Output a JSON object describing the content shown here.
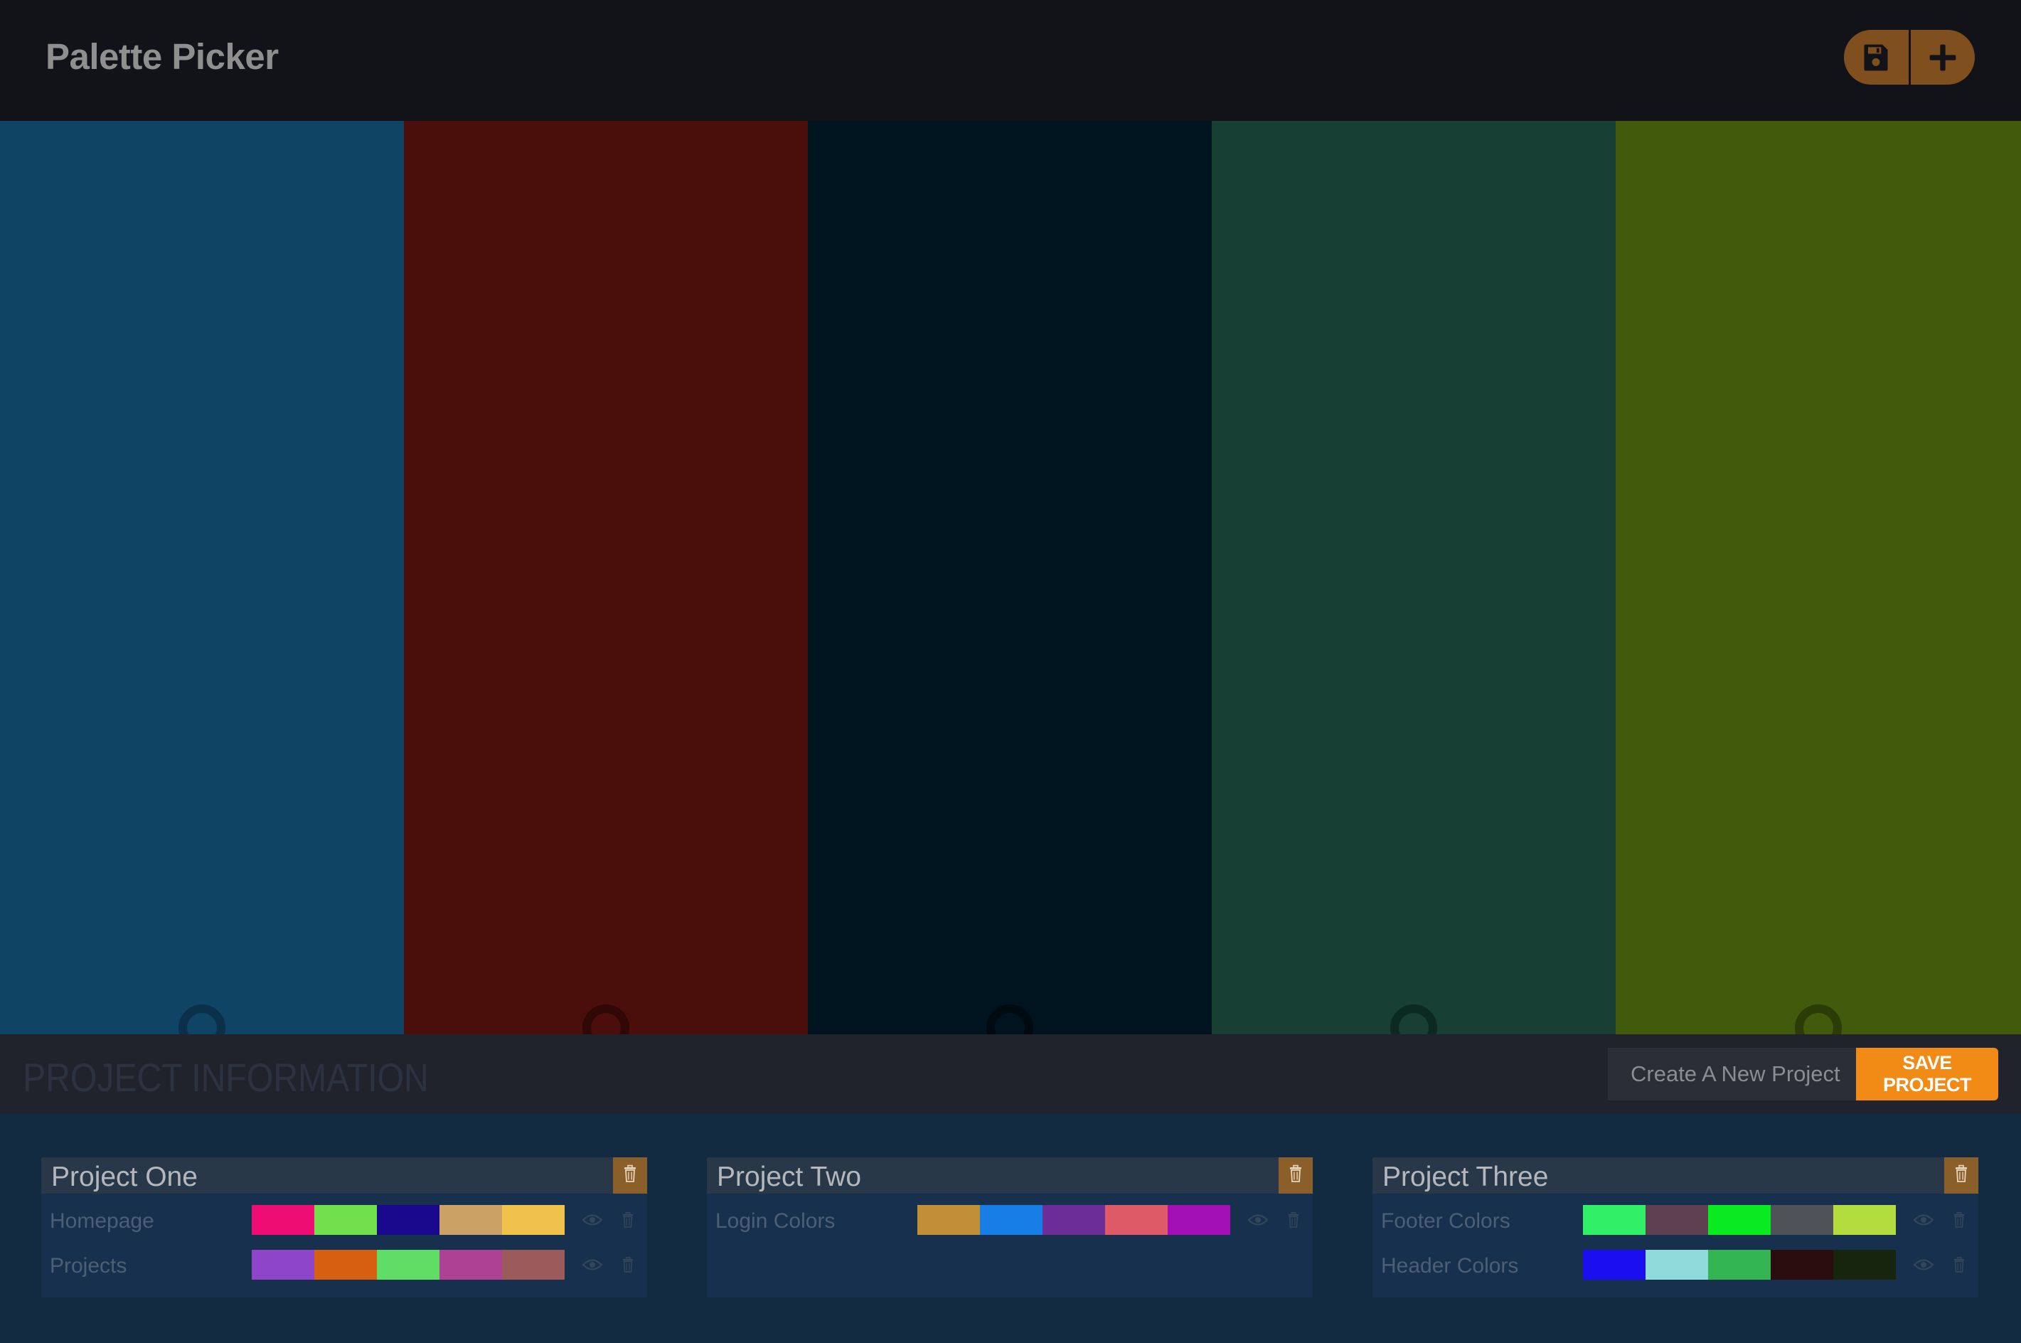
{
  "header": {
    "title": "Palette Picker",
    "save_button_icon": "floppy-disk-icon",
    "add_button_icon": "plus-icon",
    "button_color": "#7f4f1d"
  },
  "palette": {
    "colors": [
      {
        "hex": "#104464",
        "handle": "#0b3049"
      },
      {
        "hex": "#4a0f0b",
        "handle": "#300806"
      },
      {
        "hex": "#001420",
        "handle": "#000a11"
      },
      {
        "hex": "#173f34",
        "handle": "#0d2a22"
      },
      {
        "hex": "#425a0c",
        "handle": "#2b3c06"
      }
    ],
    "lock_icon": "lock-handle-icon"
  },
  "info_bar": {
    "title": "PROJECT INFORMATION",
    "new_project_placeholder": "Create A New Project",
    "save_label": "SAVE PROJECT",
    "accent": "#f28a16"
  },
  "projects": [
    {
      "name": "Project One",
      "palettes": [
        {
          "name": "Homepage",
          "colors": [
            "#ed0d73",
            "#72e04c",
            "#1a088d",
            "#cba165",
            "#f0c14b"
          ]
        },
        {
          "name": "Projects",
          "colors": [
            "#8e45c9",
            "#d65f12",
            "#5fdd65",
            "#ad4194",
            "#9c5b5b"
          ]
        }
      ]
    },
    {
      "name": "Project Two",
      "palettes": [
        {
          "name": "Login Colors",
          "colors": [
            "#c18f35",
            "#177ee8",
            "#6b2e98",
            "#dd5a66",
            "#a10fb5"
          ]
        }
      ]
    },
    {
      "name": "Project Three",
      "palettes": [
        {
          "name": "Footer Colors",
          "colors": [
            "#31ef67",
            "#5e4050",
            "#0aea20",
            "#4f5256",
            "#b3dd3f"
          ]
        },
        {
          "name": "Header Colors",
          "colors": [
            "#1a0ff1",
            "#8edbd9",
            "#34b553",
            "#2b0d10",
            "#17240e"
          ]
        }
      ]
    }
  ],
  "icons": {
    "delete": "trash-icon",
    "view": "eye-icon"
  }
}
